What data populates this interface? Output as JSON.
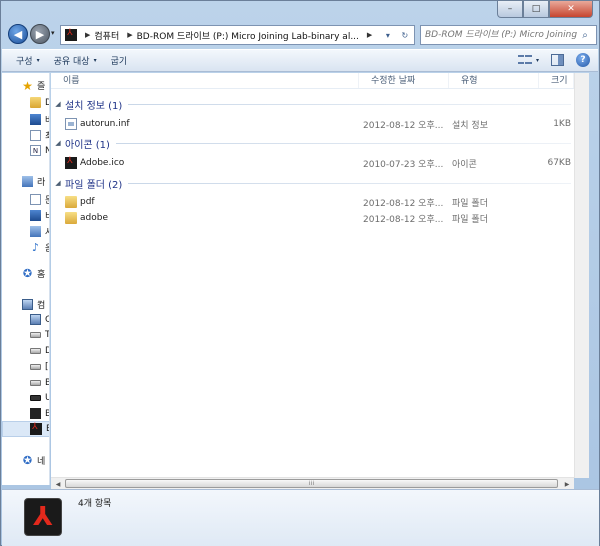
{
  "window": {
    "caption": {
      "minimize": "–",
      "maximize": "□",
      "close": "✕"
    }
  },
  "nav": {
    "back_glyph": "◀",
    "forward_glyph": "▶",
    "dropdown_glyph": "▾",
    "address": {
      "separator": "▶",
      "segments": [
        "컴퓨터",
        "BD-ROM 드라이브 (P:) Micro Joining Lab-binary al..."
      ],
      "trailing_glyph": "▶",
      "dropdown_glyph": "▾",
      "refresh_glyph": "↻"
    },
    "search": {
      "placeholder": "BD-ROM 드라이브 (P:) Micro Joining...",
      "icon": "search-icon"
    }
  },
  "toolbar": {
    "organize": "구성",
    "share_with": "공유 대상",
    "burn": "굽기",
    "caret": "▾",
    "help": "?"
  },
  "sidebar": {
    "items": [
      {
        "label": "즐",
        "icon": "star-icon",
        "glyph": "★"
      },
      {
        "label": "D",
        "icon": "folder-icon",
        "glyph": ""
      },
      {
        "label": "바",
        "icon": "desktop-icon",
        "glyph": ""
      },
      {
        "label": "최",
        "icon": "recent-icon",
        "glyph": ""
      },
      {
        "label": "N",
        "icon": "note-icon",
        "glyph": "N"
      },
      {
        "label": "라",
        "icon": "library-icon",
        "glyph": ""
      },
      {
        "label": "문",
        "icon": "documents-icon",
        "glyph": ""
      },
      {
        "label": "비",
        "icon": "video-icon",
        "glyph": ""
      },
      {
        "label": "사",
        "icon": "pictures-icon",
        "glyph": ""
      },
      {
        "label": "음",
        "icon": "music-icon",
        "glyph": "♪"
      },
      {
        "label": "홈",
        "icon": "homegroup-icon",
        "glyph": "✪"
      },
      {
        "label": "컴",
        "icon": "computer-icon",
        "glyph": ""
      },
      {
        "label": "C",
        "icon": "drive-c-icon",
        "glyph": ""
      },
      {
        "label": "T",
        "icon": "drive-icon",
        "glyph": ""
      },
      {
        "label": "D",
        "icon": "drive-icon",
        "glyph": ""
      },
      {
        "label": "[.",
        "icon": "drive-icon",
        "glyph": ""
      },
      {
        "label": "B",
        "icon": "drive-icon",
        "glyph": ""
      },
      {
        "label": "U",
        "icon": "usb-drive-icon",
        "glyph": ""
      },
      {
        "label": "B",
        "icon": "disc-drive-icon",
        "glyph": ""
      },
      {
        "label": "B",
        "icon": "pdf-drive-icon",
        "glyph": ""
      },
      {
        "label": "네",
        "icon": "network-icon",
        "glyph": "✪"
      }
    ]
  },
  "columns": {
    "name": "이름",
    "date": "수정한 날짜",
    "type": "유형",
    "size": "크기"
  },
  "groups": [
    {
      "title": "설치 정보 (1)",
      "collapse_glyph": "◢",
      "files": [
        {
          "name": "autorun.inf",
          "date": "2012-08-12 오후...",
          "type": "설치 정보",
          "size": "1KB",
          "icon": "inf-file-icon"
        }
      ]
    },
    {
      "title": "아이콘 (1)",
      "collapse_glyph": "◢",
      "files": [
        {
          "name": "Adobe.ico",
          "date": "2010-07-23 오후...",
          "type": "아이콘",
          "size": "67KB",
          "icon": "adobe-icon"
        }
      ]
    },
    {
      "title": "파일 폴더 (2)",
      "collapse_glyph": "◢",
      "files": [
        {
          "name": "pdf",
          "date": "2012-08-12 오후...",
          "type": "파일 폴더",
          "size": "",
          "icon": "folder-icon"
        },
        {
          "name": "adobe",
          "date": "2012-08-12 오후...",
          "type": "파일 폴더",
          "size": "",
          "icon": "folder-icon"
        }
      ]
    }
  ],
  "scrollbar": {
    "left": "◀",
    "right": "▶",
    "grip": "⁞⁞⁞"
  },
  "details": {
    "item_count": "4개 항목",
    "pdf_glyph": "⅄"
  },
  "colors": {
    "group_title": "#1e3287",
    "window_frame": "#bcd3ea",
    "close_button": "#c7452f"
  }
}
